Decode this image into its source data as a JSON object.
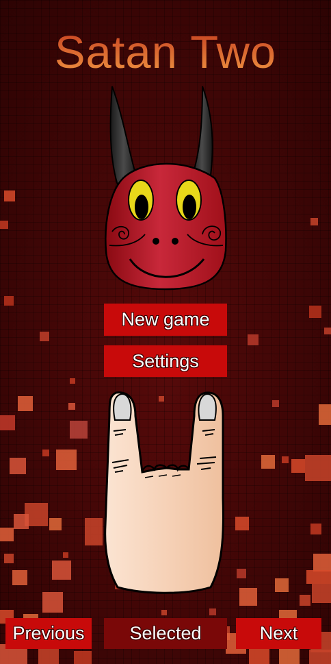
{
  "title": "Satan Two",
  "menu": {
    "new_game_label": "New game",
    "settings_label": "Settings"
  },
  "footer": {
    "previous_label": "Previous",
    "selected_label": "Selected",
    "next_label": "Next"
  },
  "icons": {
    "character": "devil-mask-icon",
    "gesture": "horns-hand-icon"
  },
  "colors": {
    "background": "#3d0505",
    "button": "#c80a0a",
    "button_selected": "#7a0808",
    "title_top": "#c23a1e",
    "title_bottom": "#f39a44"
  }
}
